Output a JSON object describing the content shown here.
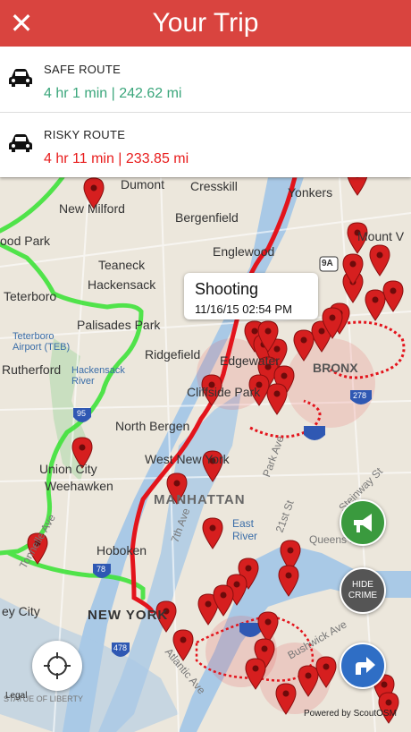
{
  "header": {
    "title": "Your Trip",
    "close_icon": "close-icon"
  },
  "routes": [
    {
      "label": "SAFE ROUTE",
      "detail": "4 hr 1 min | 242.62 mi",
      "color": "#3aa67b",
      "icon": "car-icon"
    },
    {
      "label": "RISKY ROUTE",
      "detail": "4 hr 11 min | 233.85 mi",
      "color": "#e81c1c",
      "icon": "car-icon"
    }
  ],
  "callout": {
    "title": "Shooting",
    "datetime": "11/16/15 02:54 PM"
  },
  "map": {
    "labels": [
      "Dumont",
      "Cresskill",
      "Yonkers",
      "New Milford",
      "Bergenfield",
      "Mount V",
      "ood Park",
      "Englewood",
      "Teaneck",
      "Hackensack",
      "Teterboro",
      "Palisades Park",
      "Teterboro Airport (TEB)",
      "Hackensack River",
      "Ridgefield",
      "Rutherford",
      "Edgewater",
      "Cliffside Park",
      "BRONX",
      "North Bergen",
      "West New York",
      "Union City",
      "Weehawken",
      "MANHATTAN",
      "Hoboken",
      "Tonnelle Ave",
      "Park Ave",
      "7th Ave",
      "East River",
      "21st St",
      "Steinway St",
      "Queens Blvd",
      "ey City",
      "NEW YORK",
      "Atlantic Ave",
      "Bushwick Ave",
      "STATUE OF LIBERTY",
      "9A",
      "95",
      "278",
      "78",
      "478"
    ]
  },
  "buttons": {
    "alert": "megaphone-icon",
    "hide_crime_line1": "HIDE",
    "hide_crime_line2": "CRIME",
    "navigate": "turn-right-icon",
    "locate": "crosshair-icon"
  },
  "footer": {
    "legal": "Legal",
    "powered": "Powered by ScoutOSM"
  },
  "colors": {
    "header": "#d9443f",
    "safe": "#3aa67b",
    "risky": "#e81c1c",
    "safe_route_line": "#3fe23a",
    "risky_route_line": "#e3141c"
  }
}
